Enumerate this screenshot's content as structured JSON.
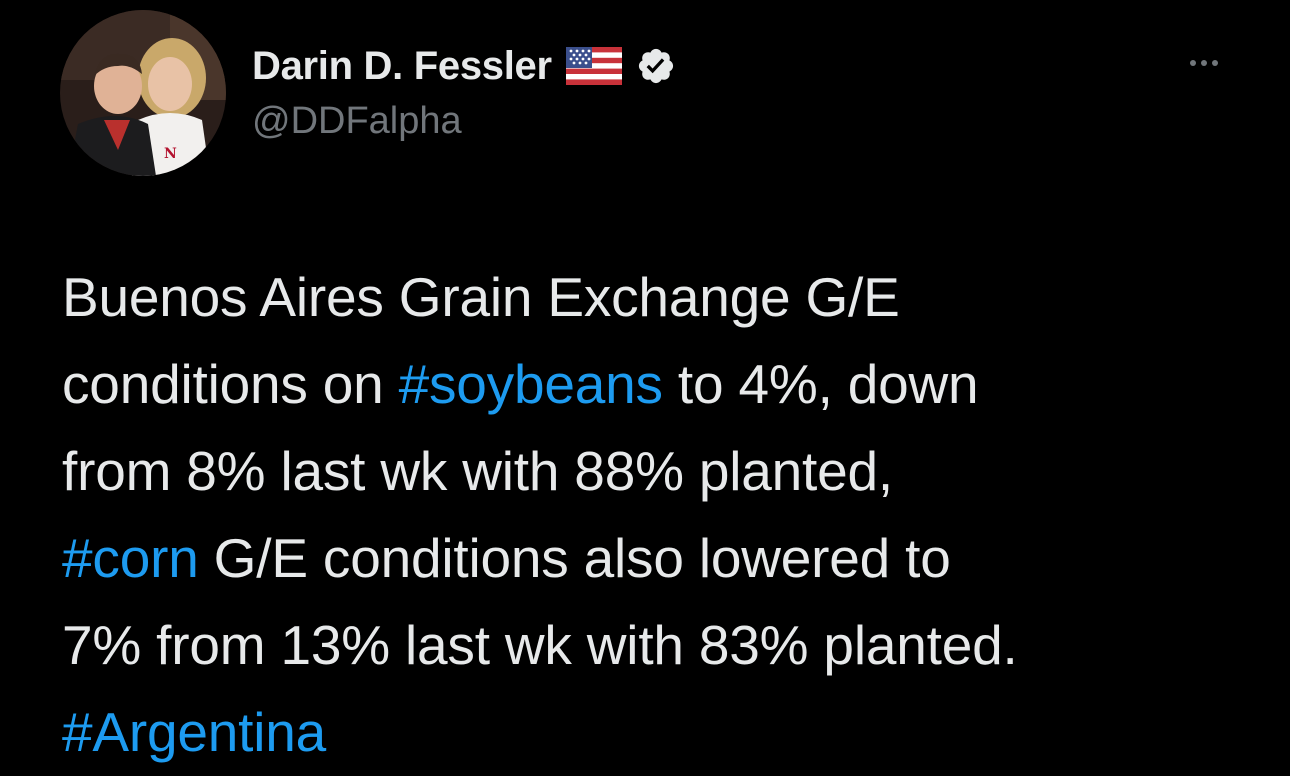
{
  "author": {
    "display_name": "Darin D. Fessler",
    "handle": "@DDFalpha",
    "flag_icon": "us-flag-icon",
    "verified_icon": "verified-badge-icon",
    "avatar": "profile-photo"
  },
  "menu": {
    "more_icon": "more-options-icon"
  },
  "tweet": {
    "l1": "Buenos Aires Grain Exchange G/E",
    "l2_a": "conditions on ",
    "l2_tag": "#soybeans",
    "l2_b": " to 4%, down",
    "l3": "from 8% last wk with 88% planted,",
    "l4_tag": "#corn",
    "l4_b": " G/E conditions also lowered to",
    "l5": "7% from 13% last wk with 83% planted.",
    "l6_tag": "#Argentina"
  },
  "colors": {
    "background": "#000000",
    "text": "#e7e9ea",
    "secondary": "#71767b",
    "link": "#1d9bf0"
  }
}
